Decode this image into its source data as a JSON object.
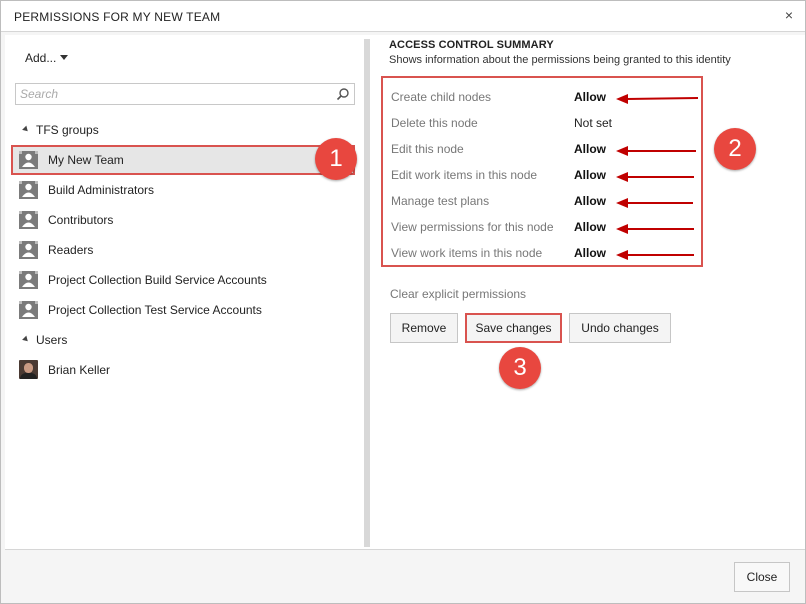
{
  "dialog": {
    "title": "PERMISSIONS FOR MY NEW TEAM",
    "close_glyph": "×"
  },
  "left": {
    "add_label": "Add...",
    "search_placeholder": "Search",
    "tfs_groups_label": "TFS groups",
    "groups": [
      {
        "label": "My New Team",
        "selected": true
      },
      {
        "label": "Build Administrators"
      },
      {
        "label": "Contributors"
      },
      {
        "label": "Readers"
      },
      {
        "label": "Project Collection Build Service Accounts"
      },
      {
        "label": "Project Collection Test Service Accounts"
      }
    ],
    "users_label": "Users",
    "users": [
      {
        "label": "Brian Keller"
      }
    ]
  },
  "summary": {
    "title": "ACCESS CONTROL SUMMARY",
    "subtitle": "Shows information about the permissions being granted to this identity",
    "permissions": [
      {
        "name": "Create child nodes",
        "value": "Allow"
      },
      {
        "name": "Delete this node",
        "value": "Not set"
      },
      {
        "name": "Edit this node",
        "value": "Allow"
      },
      {
        "name": "Edit work items in this node",
        "value": "Allow"
      },
      {
        "name": "Manage test plans",
        "value": "Allow"
      },
      {
        "name": "View permissions for this node",
        "value": "Allow"
      },
      {
        "name": "View work items in this node",
        "value": "Allow"
      }
    ],
    "clear_label": "Clear explicit permissions",
    "buttons": {
      "remove": "Remove",
      "save": "Save changes",
      "undo": "Undo changes"
    }
  },
  "callouts": [
    "1",
    "2",
    "3"
  ],
  "footer": {
    "close_label": "Close"
  },
  "colors": {
    "highlight": "#d9534f",
    "arrow": "#c00000",
    "badge": "#e8473f"
  }
}
